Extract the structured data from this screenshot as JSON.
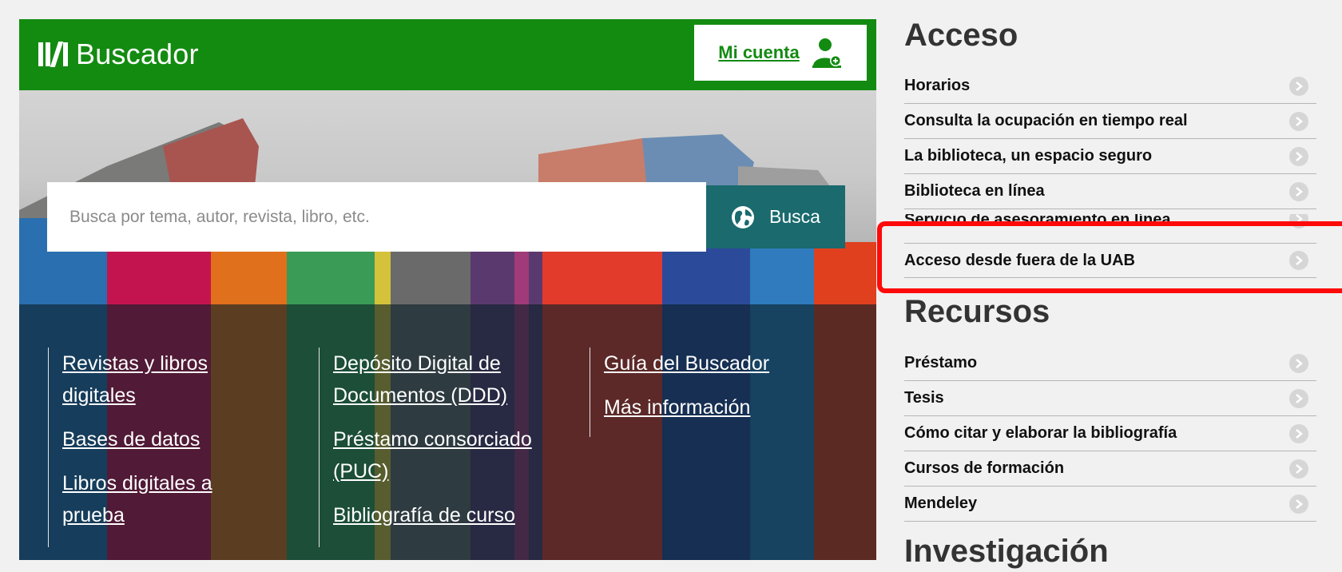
{
  "header": {
    "logo_text": "Buscador",
    "account_label": "Mi cuenta",
    "account_icon": "user-add-icon",
    "brand_color": "#138b11"
  },
  "search": {
    "placeholder": "Busca por tema, autor, revista, libro, etc.",
    "button_label": "Busca",
    "button_icon": "globe-icon",
    "button_color": "#1a6a6e"
  },
  "links": {
    "col1": [
      "Revistas y libros digitales",
      "Bases de datos",
      "Libros digitales a prueba"
    ],
    "col2": [
      "Depósito Digital de Documentos (DDD)",
      "Préstamo consorciado (PUC)",
      "Bibliografía de curso"
    ],
    "col3": [
      "Guía del Buscador",
      "Más información"
    ]
  },
  "sidebar": {
    "acceso": {
      "title": "Acceso",
      "items": [
        "Horarios",
        "Consulta la ocupación en tiempo real",
        "La biblioteca, un espacio seguro",
        "Biblioteca en línea",
        "Servicio de asesoramiento en línea",
        "Acceso desde fuera de la UAB"
      ]
    },
    "recursos": {
      "title": "Recursos",
      "items": [
        "Préstamo",
        "Tesis",
        "Cómo citar y elaborar la bibliografía",
        "Cursos de formación",
        "Mendeley"
      ]
    },
    "investigacion": {
      "title": "Investigación"
    },
    "item_icon": "chevron-right-icon",
    "highlight_color": "#ff0a0a"
  }
}
